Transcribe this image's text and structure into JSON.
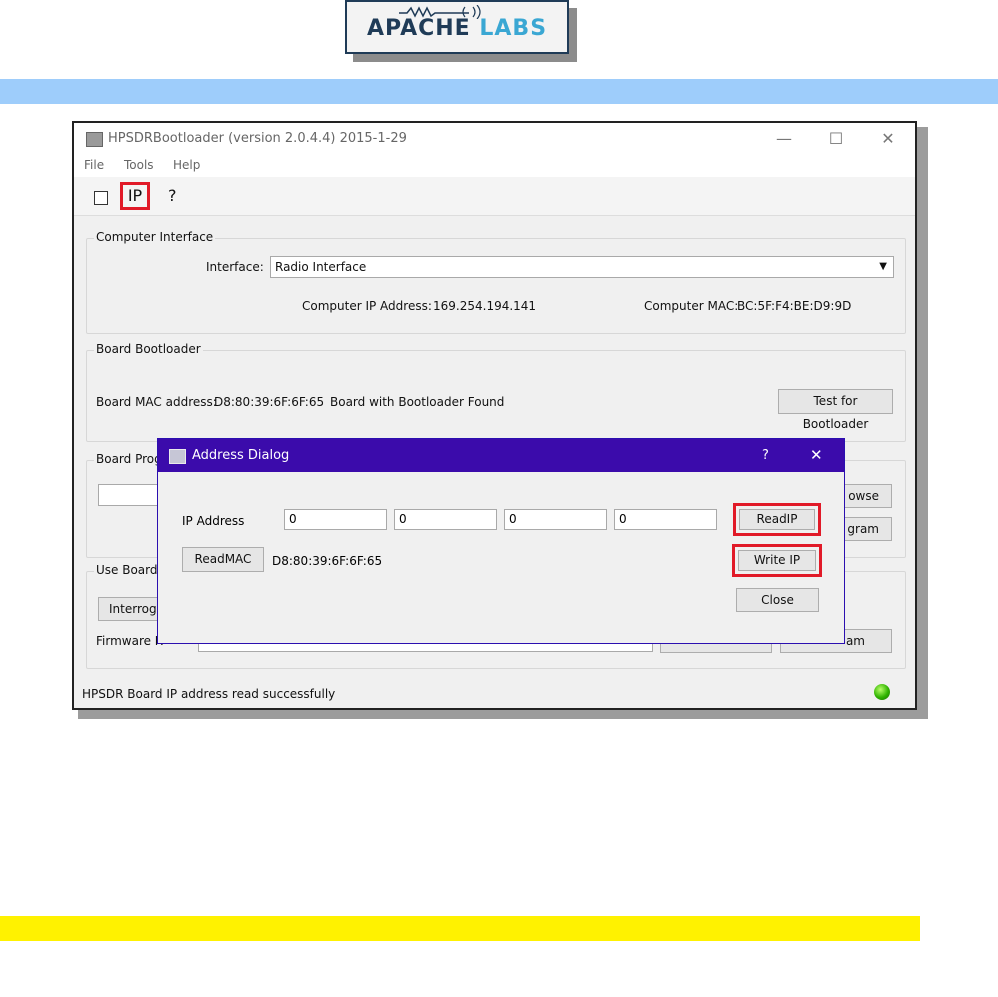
{
  "logo": {
    "text_a": "APACHE",
    "text_b": "LABS"
  },
  "window": {
    "title": "HPSDRBootloader (version 2.0.4.4) 2015-1-29",
    "controls": [
      "—",
      "☐",
      "✕"
    ],
    "menu": [
      "File",
      "Tools",
      "Help"
    ],
    "toolbar": {
      "ip": "IP",
      "help": "?"
    }
  },
  "computer_interface": {
    "group": "Computer Interface",
    "interface_label": "Interface:",
    "interface_value": "Radio Interface",
    "ip_label": "Computer IP Address:",
    "ip_value": "169.254.194.141",
    "mac_label": "Computer MAC:",
    "mac_value": "BC:5F:F4:BE:D9:9D"
  },
  "board_bootloader": {
    "group": "Board Bootloader",
    "mac_label": "Board MAC address:",
    "mac_value": "D8:80:39:6F:6F:65",
    "status": "Board with Bootloader Found",
    "test_button": "Test for Bootloader"
  },
  "board_program": {
    "group": "Board Progr",
    "browse": "owse",
    "program": "gram"
  },
  "use_board": {
    "group": "Use Board a",
    "interrogate": "Interrog",
    "firmware": "Firmware R",
    "program": "am"
  },
  "status_bar": {
    "text": "HPSDR Board IP address read successfully"
  },
  "address_dialog": {
    "title": "Address Dialog",
    "help": "?",
    "close_x": "✕",
    "ip_label": "IP Address",
    "ip_octets": [
      "0",
      "0",
      "0",
      "0"
    ],
    "readip": "ReadIP",
    "readmac": "ReadMAC",
    "mac_value": "D8:80:39:6F:6F:65",
    "writeip": "Write IP",
    "close": "Close"
  }
}
